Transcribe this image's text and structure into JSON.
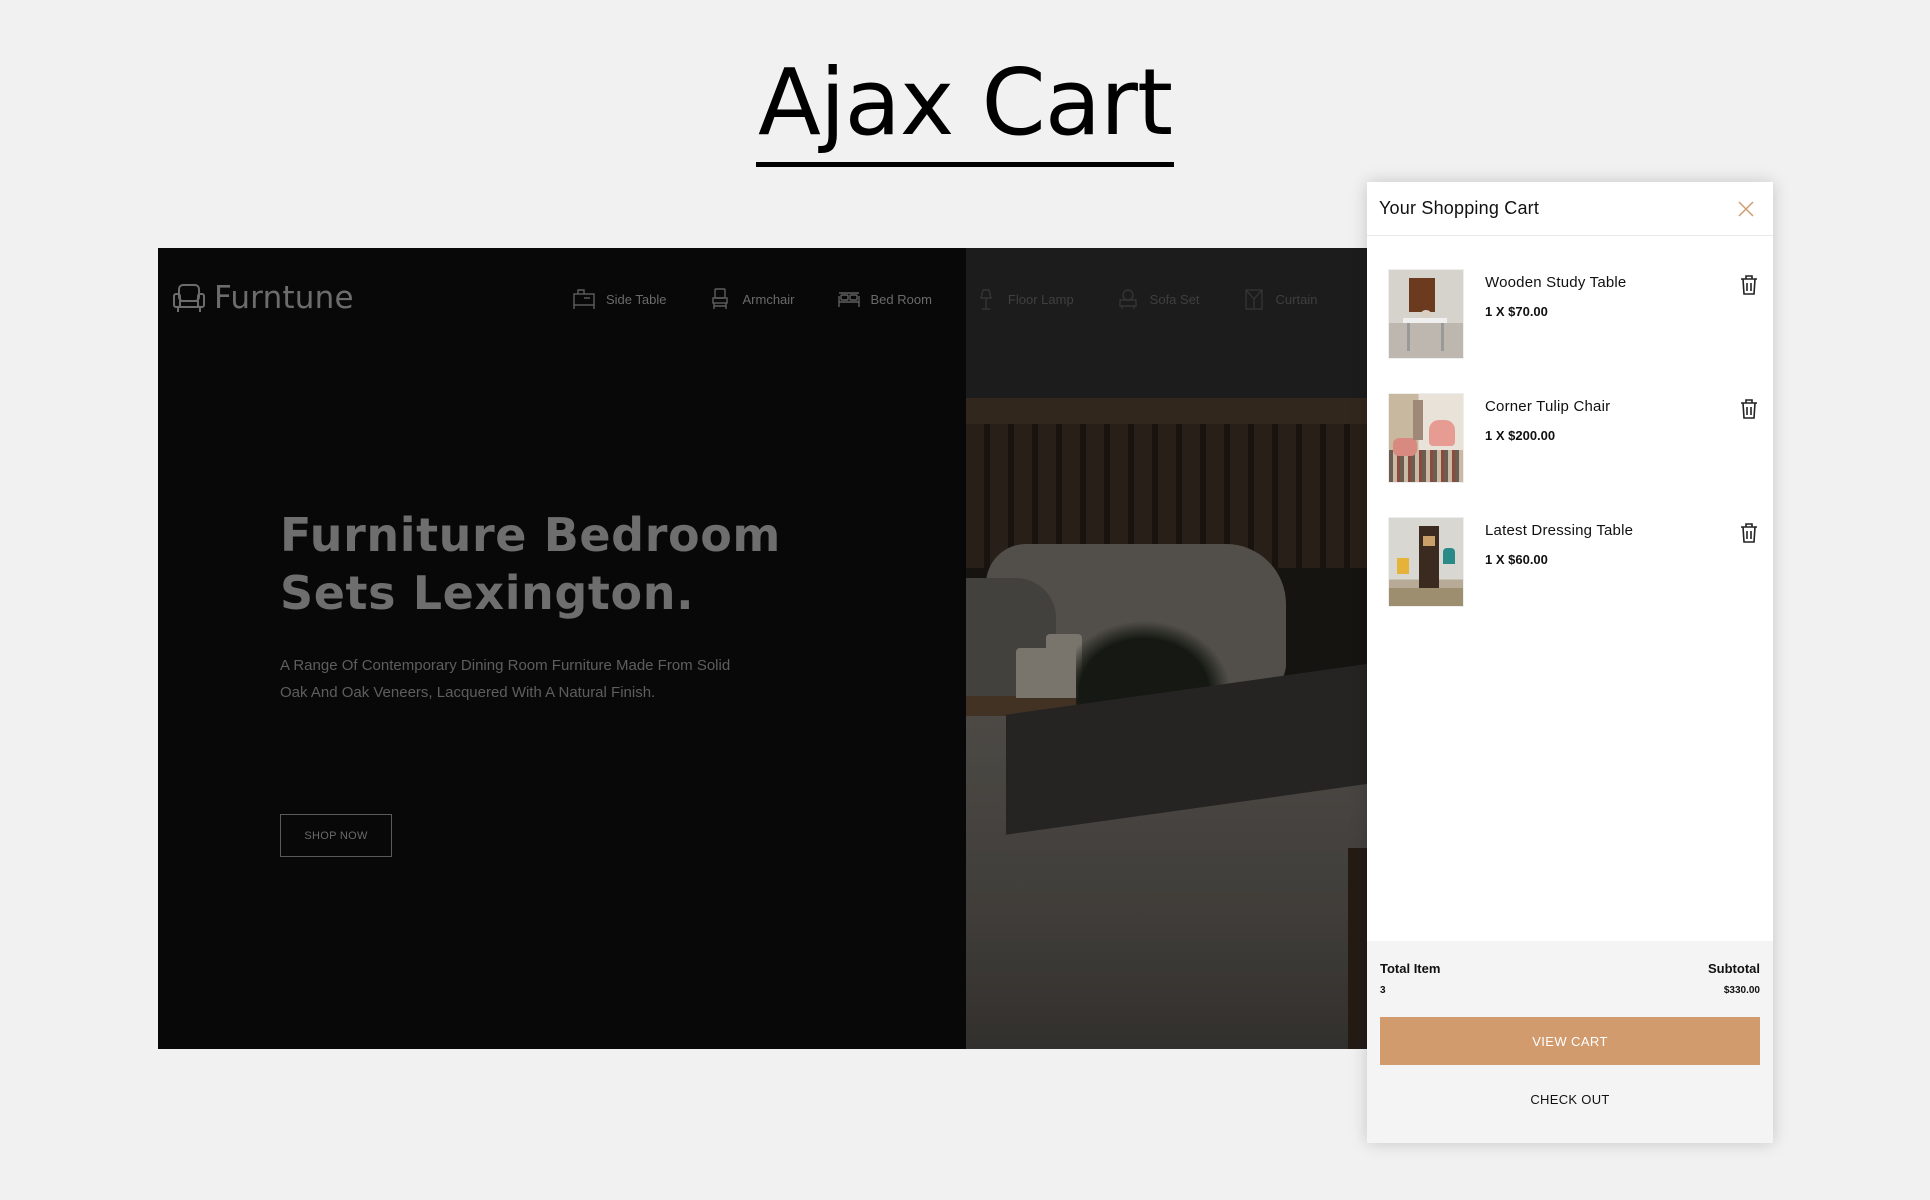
{
  "page": {
    "heading": "Ajax Cart"
  },
  "store": {
    "logo": {
      "text": "Furntune",
      "icon": "armchair-icon"
    },
    "nav": [
      {
        "label": "Side Table",
        "icon": "side-table-icon"
      },
      {
        "label": "Armchair",
        "icon": "armchair-icon"
      },
      {
        "label": "Bed Room",
        "icon": "bed-icon"
      },
      {
        "label": "Floor Lamp",
        "icon": "floor-lamp-icon"
      },
      {
        "label": "Sofa Set",
        "icon": "sofa-icon"
      },
      {
        "label": "Curtain",
        "icon": "curtain-icon"
      }
    ],
    "hero": {
      "title_line1": "Furniture Bedroom",
      "title_line2": "Sets Lexington.",
      "description": "A Range Of Contemporary Dining Room Furniture Made From Solid Oak And Oak Veneers, Lacquered With A Natural Finish.",
      "button": "SHOP NOW"
    }
  },
  "cart": {
    "title": "Your Shopping Cart",
    "items": [
      {
        "name": "Wooden Study Table",
        "qty_price": "1 X $70.00"
      },
      {
        "name": "Corner Tulip Chair",
        "qty_price": "1 X $200.00"
      },
      {
        "name": "Latest Dressing Table",
        "qty_price": "1 X $60.00"
      }
    ],
    "total_item_label": "Total Item",
    "total_item_value": "3",
    "subtotal_label": "Subtotal",
    "subtotal_value": "$330.00",
    "view_cart": "VIEW CART",
    "checkout": "CHECK OUT"
  },
  "colors": {
    "accent": "#d29b6d",
    "background": "#f1f1f1",
    "hero_dark": "#080808"
  }
}
